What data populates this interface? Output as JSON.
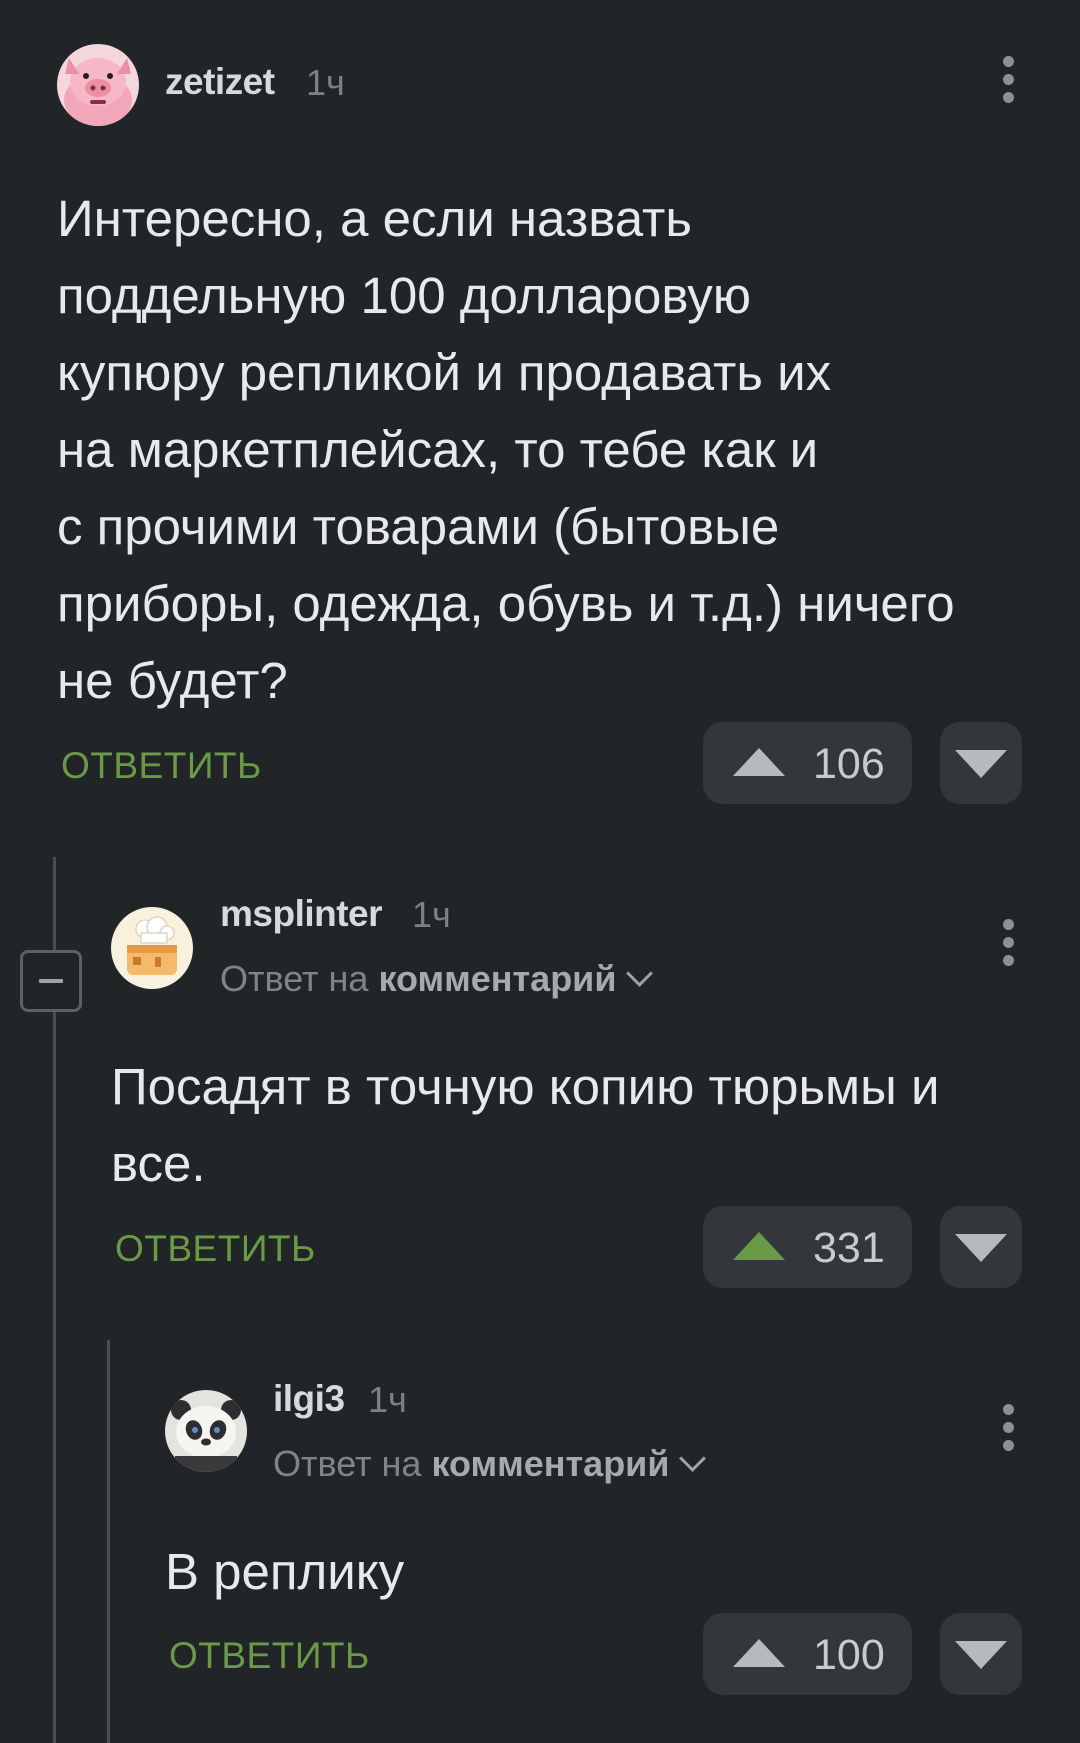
{
  "comments": [
    {
      "username": "zetizet",
      "time": "1ч",
      "avatar_icon": "pig-avatar-icon",
      "text": "Интересно, а если назвать\nподдельную 100 долларовую\nкупюру репликой и продавать их\nна маркетплейсах, то тебе как и\nс прочими товарами (бытовые\nприборы, одежда, обувь и т.д.) ничего\nне будет?",
      "reply_label": "ОТВЕТИТЬ",
      "rating": "106",
      "upvoted": false
    },
    {
      "username": "msplinter",
      "time": "1ч",
      "avatar_icon": "chef-avatar-icon",
      "reply_to_prefix": "Ответ на",
      "reply_to_target": "комментарий",
      "text": "Посадят в точную копию тюрьмы и\nвсе.",
      "reply_label": "ОТВЕТИТЬ",
      "rating": "331",
      "upvoted": true
    },
    {
      "username": "ilgi3",
      "time": "1ч",
      "avatar_icon": "panda-avatar-icon",
      "reply_to_prefix": "Ответ на",
      "reply_to_target": "комментарий",
      "text": "В реплику",
      "reply_label": "ОТВЕТИТЬ",
      "rating": "100",
      "upvoted": false
    }
  ],
  "colors": {
    "background": "#222528",
    "accent_green": "#6b9a46",
    "vote_button": "#33373b"
  }
}
